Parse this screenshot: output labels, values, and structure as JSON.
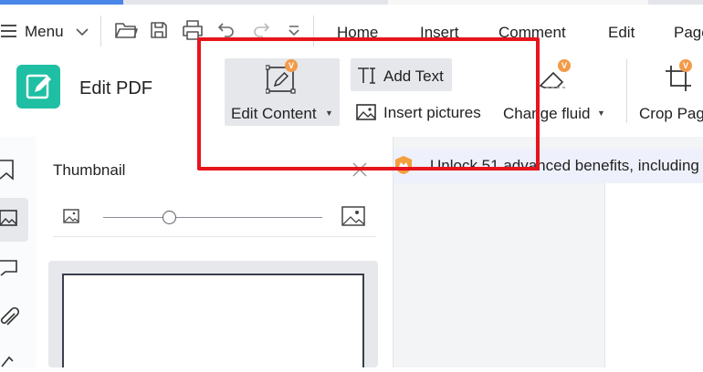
{
  "menubar": {
    "menu_label": "Menu",
    "tabs": [
      "Home",
      "Insert",
      "Comment",
      "Edit",
      "Page"
    ]
  },
  "app": {
    "title": "Edit PDF"
  },
  "ribbon": {
    "edit_content": "Edit Content",
    "add_text": "Add Text",
    "insert_pictures": "Insert pictures",
    "change_fluid": "Change fluid",
    "crop_page": "Crop Page",
    "premium_badge": "V"
  },
  "thumbnail": {
    "title": "Thumbnail",
    "slider_value": 0.3
  },
  "banner": {
    "text": "Unlock 51 advanced benefits, including"
  },
  "colors": {
    "accent": "#1fbfa3",
    "highlight": "#e8141c",
    "badge": "#f29a4a",
    "tab_active": "#4a86e8"
  }
}
